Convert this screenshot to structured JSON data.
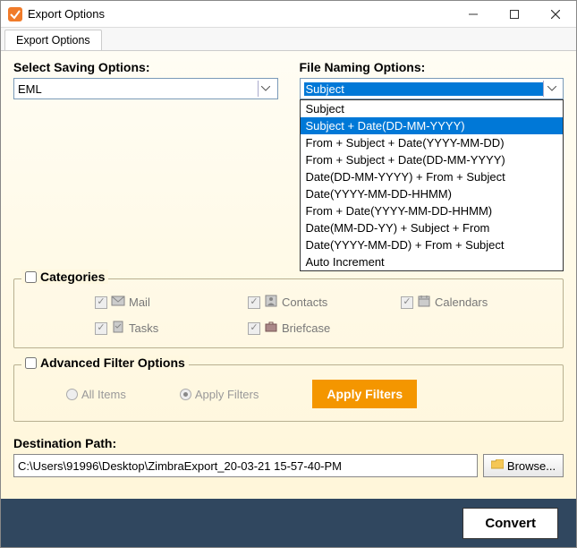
{
  "window": {
    "title": "Export Options",
    "tab": "Export Options"
  },
  "saving": {
    "label": "Select Saving Options:",
    "value": "EML"
  },
  "naming": {
    "label": "File Naming Options:",
    "value": "Subject",
    "options": [
      "Subject",
      "Subject + Date(DD-MM-YYYY)",
      "From + Subject + Date(YYYY-MM-DD)",
      "From + Subject + Date(DD-MM-YYYY)",
      "Date(DD-MM-YYYY) + From + Subject",
      "Date(YYYY-MM-DD-HHMM)",
      "From + Date(YYYY-MM-DD-HHMM)",
      "Date(MM-DD-YY) + Subject + From",
      "Date(YYYY-MM-DD) + From + Subject",
      "Auto Increment"
    ],
    "highlighted_index": 1
  },
  "categories": {
    "legend": "Categories",
    "items": {
      "mail": "Mail",
      "contacts": "Contacts",
      "calendars": "Calendars",
      "tasks": "Tasks",
      "briefcase": "Briefcase"
    }
  },
  "advanced": {
    "legend": "Advanced Filter Options",
    "all_items": "All Items",
    "apply_filters_radio": "Apply Filters",
    "apply_filters_btn": "Apply Filters"
  },
  "destination": {
    "label": "Destination Path:",
    "value": "C:\\Users\\91996\\Desktop\\ZimbraExport_20-03-21 15-57-40-PM",
    "browse": "Browse..."
  },
  "footer": {
    "convert": "Convert"
  }
}
